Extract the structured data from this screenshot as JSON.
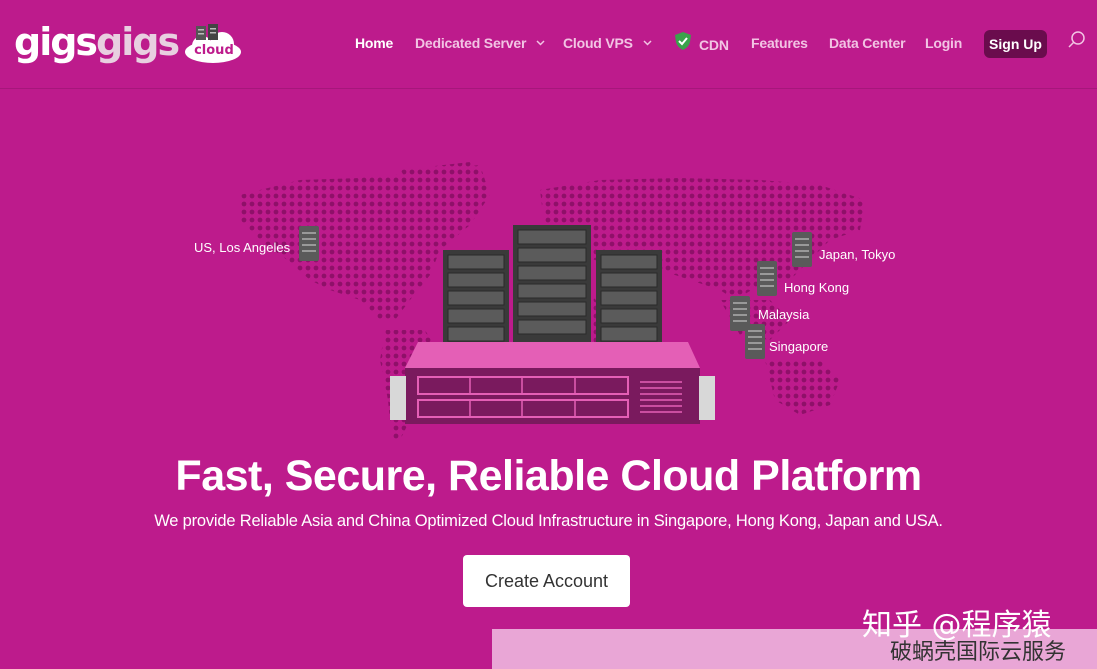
{
  "brand": {
    "logo_word_1": "gigs",
    "logo_word_2": "gigs",
    "logo_badge": "cloud",
    "primary_color": "#bd1b8c",
    "dark_accent": "#6a0c4d"
  },
  "nav": {
    "items": [
      {
        "label": "Home",
        "active": true
      },
      {
        "label": "Dedicated Server",
        "has_dropdown": true
      },
      {
        "label": "Cloud VPS",
        "has_dropdown": true
      },
      {
        "label": "CDN",
        "icon": "shield-icon"
      },
      {
        "label": "Features"
      },
      {
        "label": "Data Center"
      },
      {
        "label": "Login"
      }
    ],
    "signup_label": "Sign Up",
    "search_icon": "search-icon"
  },
  "map": {
    "locations": [
      {
        "label": "US, Los Angeles"
      },
      {
        "label": "Japan, Tokyo"
      },
      {
        "label": "Hong Kong"
      },
      {
        "label": "Malaysia"
      },
      {
        "label": "Singapore"
      }
    ]
  },
  "hero": {
    "title": "Fast, Secure, Reliable Cloud Platform",
    "subtitle": "We provide Reliable Asia and China Optimized Cloud Infrastructure in Singapore, Hong Kong, Japan and USA.",
    "cta_label": "Create Account"
  },
  "watermark": {
    "line1": "知乎 @程序猿",
    "line2": "破蜗壳国际云服务"
  }
}
